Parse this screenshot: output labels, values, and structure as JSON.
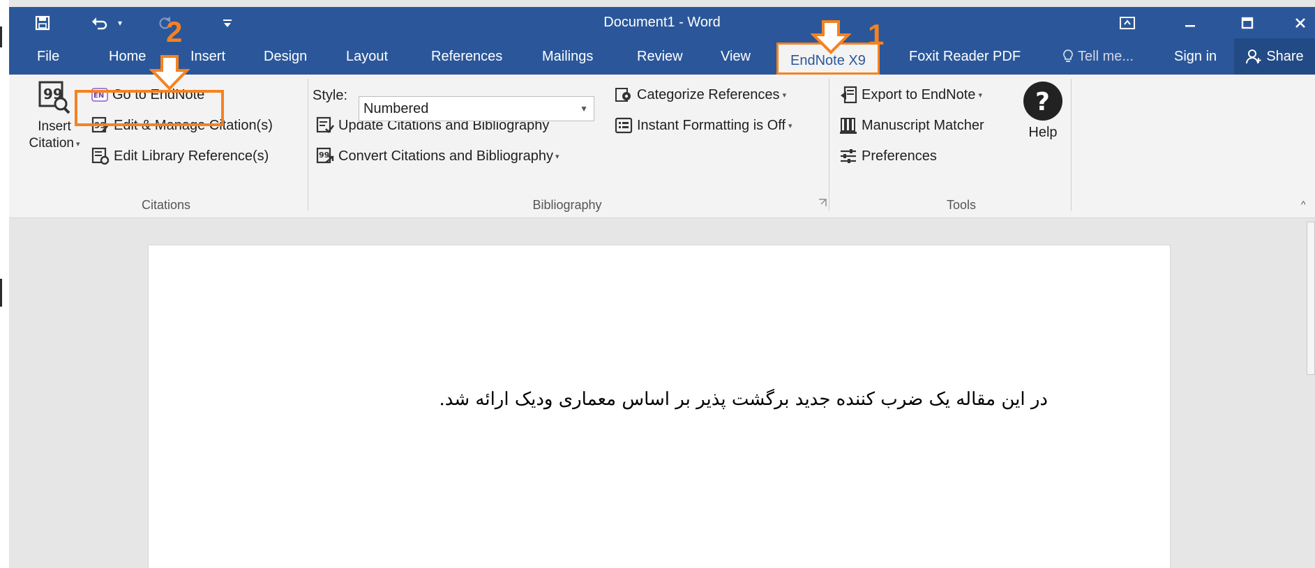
{
  "window": {
    "title": "Document1 - Word",
    "qat": {
      "save_icon": "save-icon",
      "undo_icon": "undo-icon",
      "redo_icon": "redo-icon",
      "customize_icon": "customize-qat-icon"
    },
    "controls": [
      "ribbon-display-icon",
      "minimize-icon",
      "maximize-icon",
      "close-icon"
    ],
    "accent": "#2b579a"
  },
  "tabs": {
    "file": "File",
    "home": "Home",
    "insert": "Insert",
    "design": "Design",
    "layout": "Layout",
    "references": "References",
    "mailings": "Mailings",
    "review": "Review",
    "view": "View",
    "endnote": "EndNote X9",
    "foxit": "Foxit Reader PDF",
    "tellme": "Tell me...",
    "signin": "Sign in",
    "share": "Share"
  },
  "ribbon": {
    "citations": {
      "insert_citation_line1": "Insert",
      "insert_citation_line2": "Citation",
      "go_to_endnote": "Go to EndNote",
      "edit_manage": "Edit & Manage Citation(s)",
      "edit_library": "Edit Library Reference(s)",
      "group_label": "Citations"
    },
    "bibliography": {
      "style_label": "Style:",
      "style_value": "Numbered",
      "update": "Update Citations and Bibliography",
      "convert": "Convert Citations and Bibliography",
      "categorize": "Categorize References",
      "instant_formatting": "Instant Formatting is Off",
      "group_label": "Bibliography"
    },
    "tools": {
      "export": "Export to EndNote",
      "manuscript": "Manuscript Matcher",
      "preferences": "Preferences",
      "help": "Help",
      "group_label": "Tools"
    }
  },
  "document": {
    "text": "در این مقاله یک ضرب کننده جدید برگشت پذیر بر اساس معماری ودیک ارائه شد."
  },
  "annotations": {
    "step1": "1",
    "step2": "2",
    "color": "#f58220"
  }
}
